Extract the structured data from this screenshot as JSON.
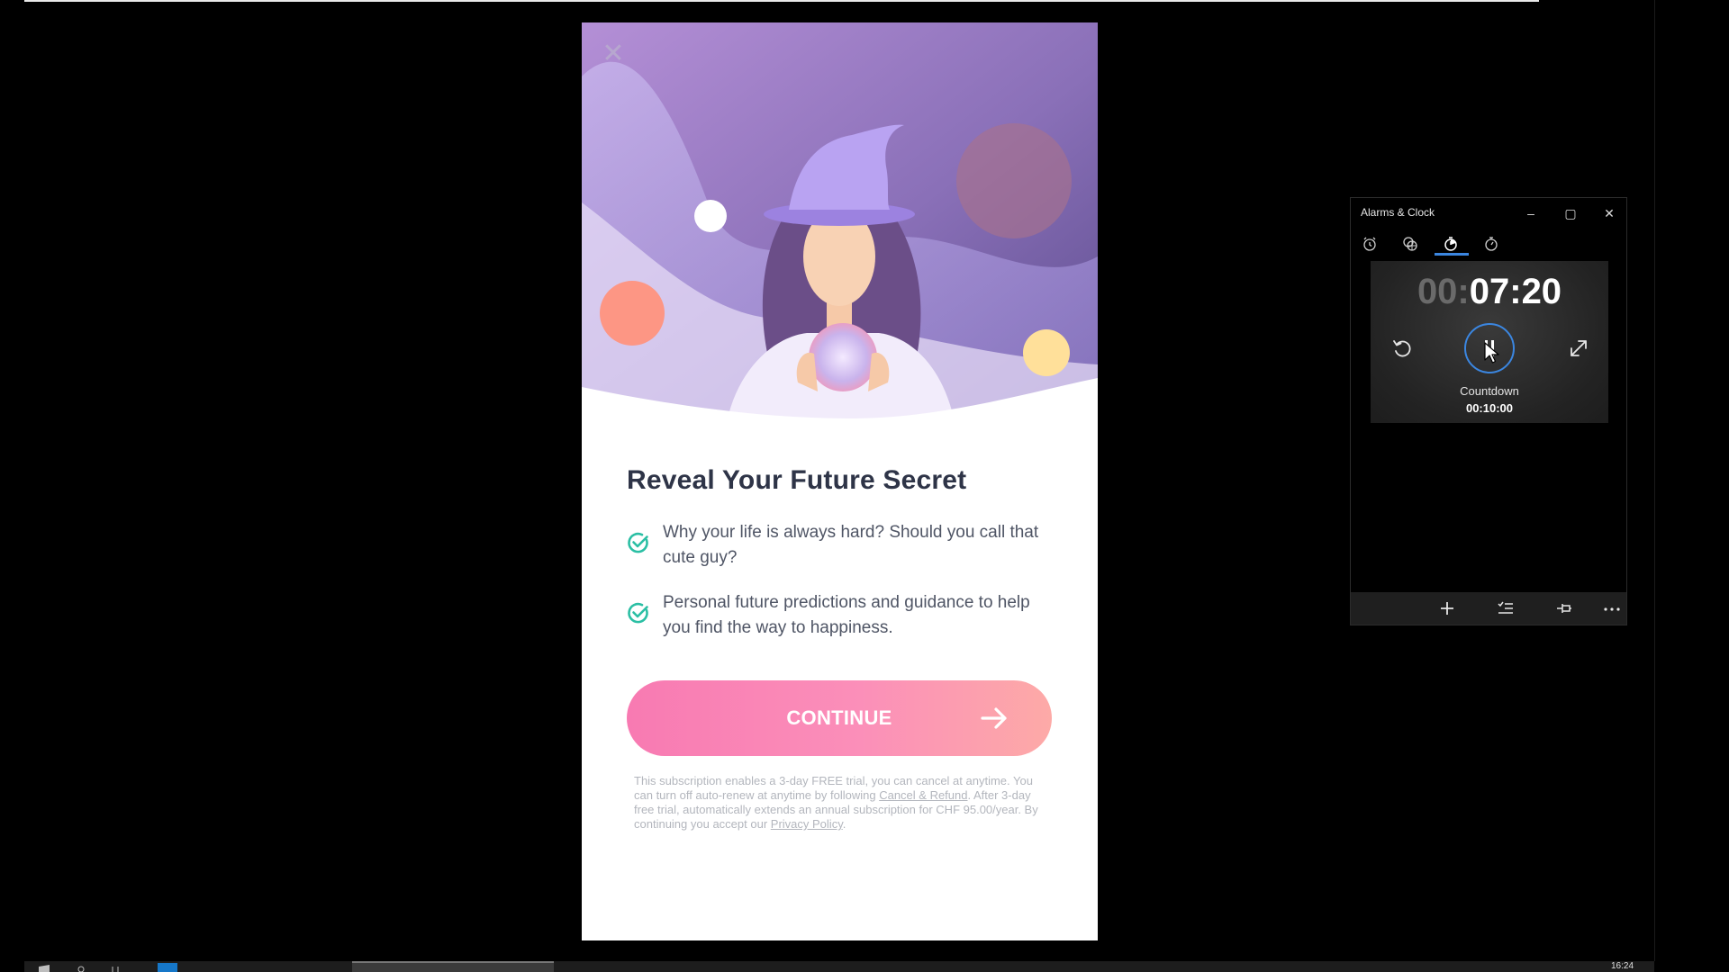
{
  "app": {
    "title": "Reveal Your Future Secret",
    "features": [
      "Why your life is always hard? Should you call that cute guy?",
      "Personal future predictions and guidance to help you find the way to happiness."
    ],
    "continue_label": "CONTINUE",
    "legal": {
      "line1": "This subscription enables a 3-day FREE trial, you can cancel at anytime. You can turn off auto-renew at anytime by following",
      "cancel_link": "Cancel & Refund",
      "line2": ". After 3-day free trial, automatically extends an annual subscription for CHF 95.00/year. By continuing you accept our",
      "privacy_link": "Privacy Policy",
      "end": "."
    },
    "colors": {
      "accent_pink": "#f87ab2",
      "title": "#2e3447",
      "check": "#2bbfa4"
    }
  },
  "clock_window": {
    "title": "Alarms & Clock",
    "tabs": [
      "alarm-icon",
      "world-clock-icon",
      "timer-icon",
      "stopwatch-icon"
    ],
    "active_tab": "timer-icon",
    "timer": {
      "hours": "00:",
      "minsec": "07:20",
      "name": "Countdown",
      "duration": "00:10:00",
      "state": "running"
    },
    "colors": {
      "accent": "#3b86e0"
    }
  },
  "taskbar": {
    "time": "16:24"
  }
}
